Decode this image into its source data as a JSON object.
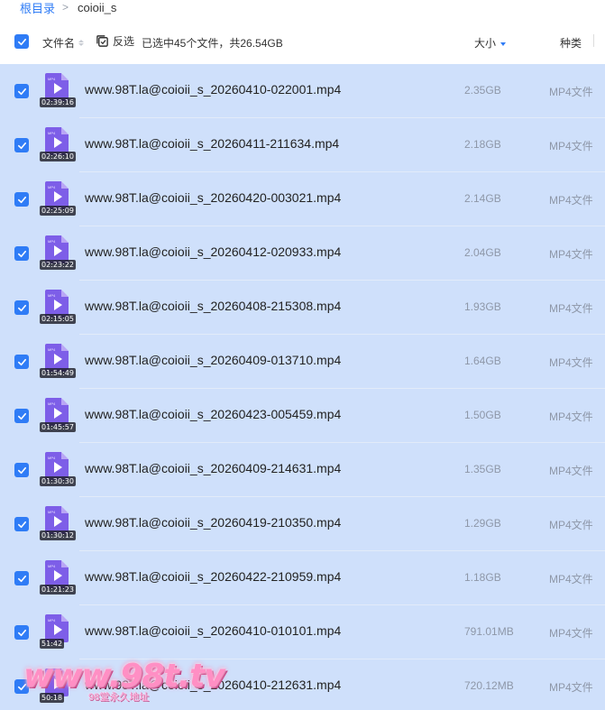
{
  "breadcrumb": {
    "root": "根目录",
    "separator": ">",
    "current": "coioii_s"
  },
  "header": {
    "col_name": "文件名",
    "invert_label": "反选",
    "selected_info": "已选中45个文件，共26.54GB",
    "col_size": "大小",
    "col_type": "种类"
  },
  "colors": {
    "accent": "#2f7cf6",
    "selected_row": "#cfe0fb",
    "file_icon": "#7d5ee8"
  },
  "files": [
    {
      "name": "www.98T.la@coioii_s_20260410-022001.mp4",
      "duration": "02:39:16",
      "size": "2.35GB",
      "type": "MP4文件",
      "checked": true
    },
    {
      "name": "www.98T.la@coioii_s_20260411-211634.mp4",
      "duration": "02:26:10",
      "size": "2.18GB",
      "type": "MP4文件",
      "checked": true
    },
    {
      "name": "www.98T.la@coioii_s_20260420-003021.mp4",
      "duration": "02:25:09",
      "size": "2.14GB",
      "type": "MP4文件",
      "checked": true
    },
    {
      "name": "www.98T.la@coioii_s_20260412-020933.mp4",
      "duration": "02:23:22",
      "size": "2.04GB",
      "type": "MP4文件",
      "checked": true
    },
    {
      "name": "www.98T.la@coioii_s_20260408-215308.mp4",
      "duration": "02:15:05",
      "size": "1.93GB",
      "type": "MP4文件",
      "checked": true
    },
    {
      "name": "www.98T.la@coioii_s_20260409-013710.mp4",
      "duration": "01:54:49",
      "size": "1.64GB",
      "type": "MP4文件",
      "checked": true
    },
    {
      "name": "www.98T.la@coioii_s_20260423-005459.mp4",
      "duration": "01:45:57",
      "size": "1.50GB",
      "type": "MP4文件",
      "checked": true
    },
    {
      "name": "www.98T.la@coioii_s_20260409-214631.mp4",
      "duration": "01:30:30",
      "size": "1.35GB",
      "type": "MP4文件",
      "checked": true
    },
    {
      "name": "www.98T.la@coioii_s_20260419-210350.mp4",
      "duration": "01:30:12",
      "size": "1.29GB",
      "type": "MP4文件",
      "checked": true
    },
    {
      "name": "www.98T.la@coioii_s_20260422-210959.mp4",
      "duration": "01:21:23",
      "size": "1.18GB",
      "type": "MP4文件",
      "checked": true
    },
    {
      "name": "www.98T.la@coioii_s_20260410-010101.mp4",
      "duration": "51:42",
      "size": "791.01MB",
      "type": "MP4文件",
      "checked": true
    },
    {
      "name": "www.98T.la@coioii_s_20260410-212631.mp4",
      "duration": "50:18",
      "size": "720.12MB",
      "type": "MP4文件",
      "checked": true
    }
  ],
  "watermark": {
    "text": "www.98t.tv",
    "subtitle": "98堂永久地址"
  }
}
